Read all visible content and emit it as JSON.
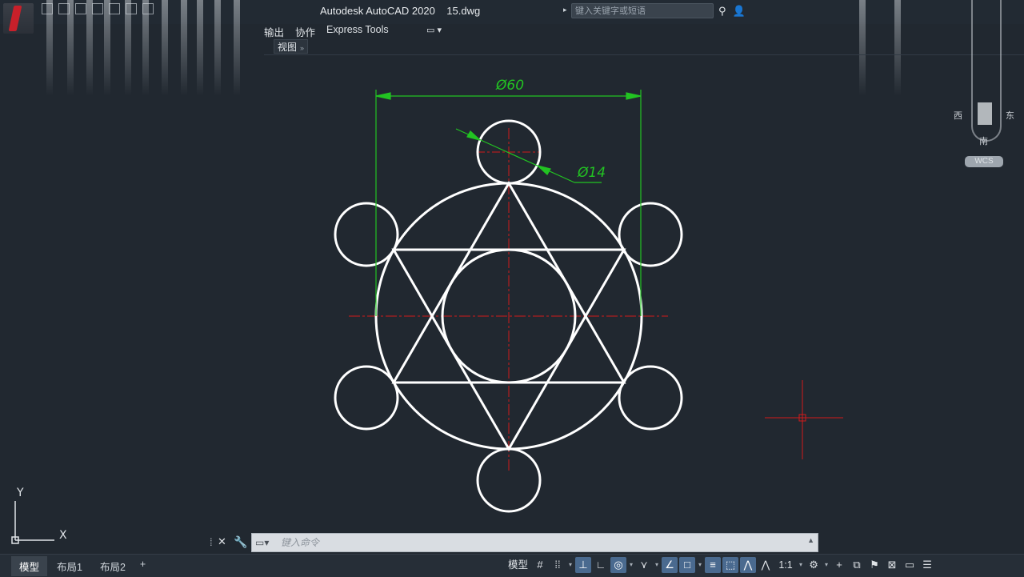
{
  "app": {
    "title": "Autodesk AutoCAD 2020    15.dwg",
    "search_placeholder": "键入关键字或短语"
  },
  "menu": {
    "items": [
      "输出",
      "协作",
      "Express Tools"
    ],
    "view_tab": "视图",
    "view_tab_arrow": "»"
  },
  "viewcube": {
    "west": "西",
    "east": "东",
    "south": "南",
    "wcs": "WCS"
  },
  "drawing": {
    "dim_outer": "Ø60",
    "dim_small": "Ø14",
    "ucs_x": "X",
    "ucs_y": "Y",
    "colors": {
      "geometry": "#ffffff",
      "dimension": "#22c322",
      "centerline": "#d11a1a",
      "background": "#212830"
    }
  },
  "command": {
    "placeholder": "键入命令"
  },
  "statusbar": {
    "tabs": [
      "模型",
      "布局1",
      "布局2"
    ],
    "model_label": "模型",
    "scale": "1:1"
  }
}
